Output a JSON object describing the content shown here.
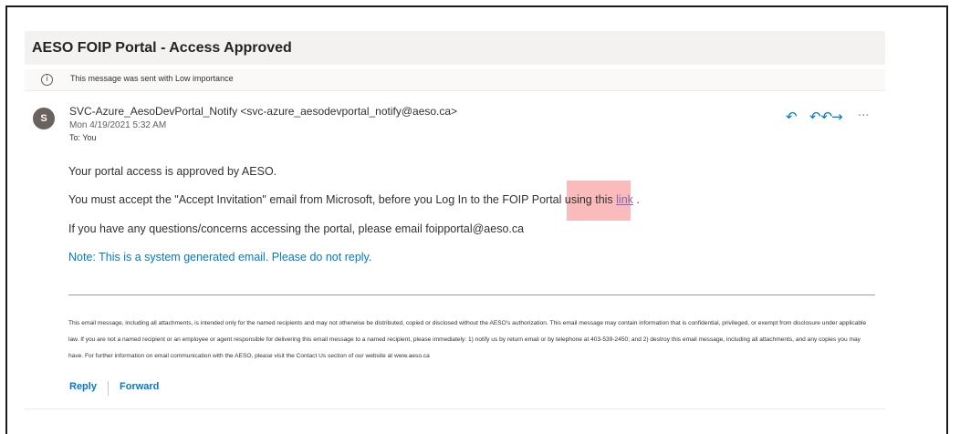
{
  "email": {
    "subject": "AESO FOIP Portal - Access Approved",
    "importance_note": "This message was sent with Low importance",
    "avatar_initial": "S",
    "sender": "SVC-Azure_AesoDevPortal_Notify <svc-azure_aesodevportal_notify@aeso.ca>",
    "date": "Mon 4/19/2021 5:32 AM",
    "to": "To: You",
    "body": {
      "line1": "Your portal access is approved by AESO.",
      "line2_before": "You must accept the \"Accept Invitation\" email from Microsoft, before you Log In to the FOIP Portal using this ",
      "line2_link": "link",
      "line2_after": " .",
      "line3": "If you have any questions/concerns accessing the portal, please email foipportal@aeso.ca",
      "note": "Note: This is a system generated email. Please do not reply."
    },
    "disclaimer": "This email message, including all attachments, is intended only for the named recipients and may not otherwise be distributed, copied or disclosed without the AESO's authorization. This email message may contain information that is confidential, privileged, or exempt from disclosure under applicable law. If you are not a named recipient or an employee or agent responsible for delivering this email message to a named recipient, please immediately: 1) notify us by return email or by telephone at 403-539-2450; and 2) destroy this email message, including all attachments, and any copies you may have. For further information on email communication with the AESO, please visit the Contact Us section of our website at www.aeso.ca"
  },
  "actions": {
    "reply_icon": "reply-icon",
    "reply_all_icon": "reply-all-icon",
    "forward_icon": "forward-icon",
    "more_icon": "more-icon"
  },
  "footer": {
    "reply_label": "Reply",
    "forward_label": "Forward"
  },
  "colors": {
    "accent": "#0078d4",
    "highlight": "#f8b4b4",
    "avatar": "#69625f"
  }
}
